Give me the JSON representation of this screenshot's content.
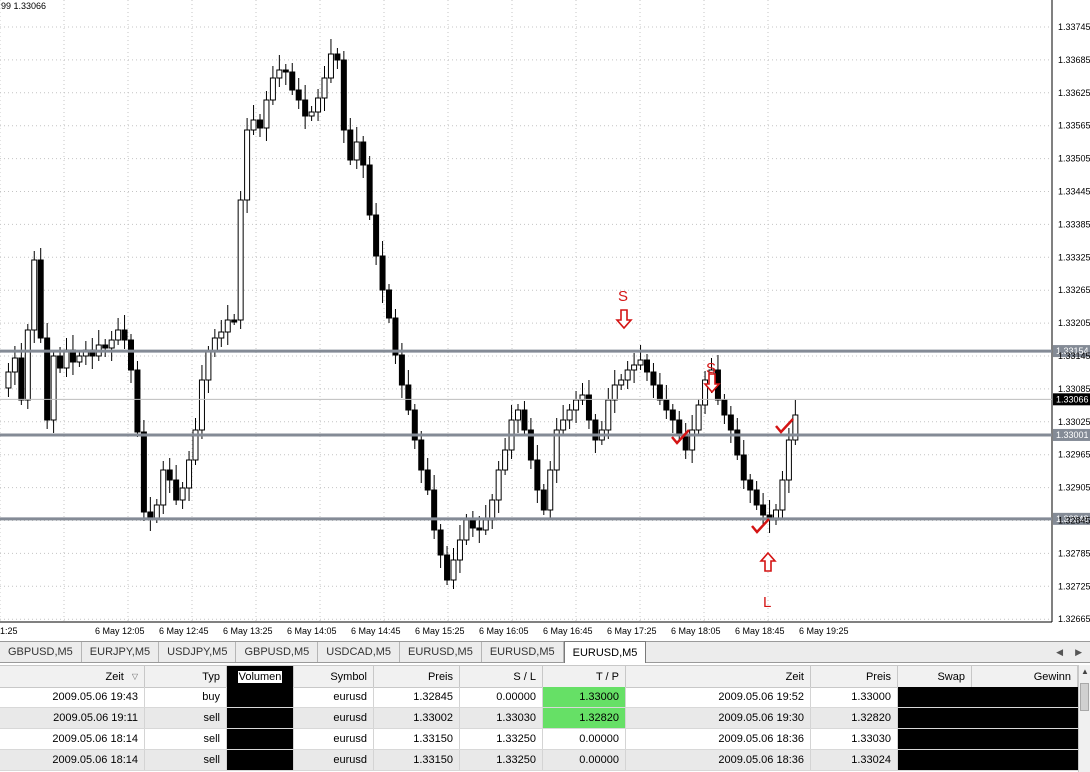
{
  "chart": {
    "header": "99 1.33066",
    "y_ticks": [
      "1.33745",
      "1.33685",
      "1.33625",
      "1.33565",
      "1.33505",
      "1.33445",
      "1.33385",
      "1.33325",
      "1.33265",
      "1.33205",
      "1.33145",
      "1.33085",
      "1.33025",
      "1.32965",
      "1.32905",
      "1.32845",
      "1.32785",
      "1.32725",
      "1.32665"
    ],
    "x_ticks": [
      "1:25",
      "6 May 12:05",
      "6 May 12:45",
      "6 May 13:25",
      "6 May 14:05",
      "6 May 14:45",
      "6 May 15:25",
      "6 May 16:05",
      "6 May 16:45",
      "6 May 17:25",
      "6 May 18:05",
      "6 May 18:45",
      "6 May 19:25"
    ],
    "levels": [
      {
        "label": "1.33154",
        "value": 1.33154
      },
      {
        "label": "1.33001",
        "value": 1.33001
      },
      {
        "label": "1.32848",
        "value": 1.32848
      }
    ],
    "current_price": "1.33066",
    "annotations": {
      "sell_1": "S",
      "sell_2": "S",
      "long": "L"
    },
    "colors": {
      "level_line": "#848b96",
      "annotation": "#d41414",
      "bull": "#ffffff",
      "bear": "#000000"
    }
  },
  "tabs": [
    "GBPUSD,M5",
    "EURJPY,M5",
    "USDJPY,M5",
    "GBPUSD,M5",
    "USDCAD,M5",
    "EURUSD,M5",
    "EURUSD,M5",
    "EURUSD,M5"
  ],
  "active_tab": 7,
  "table": {
    "headers": {
      "zeit": "Zeit",
      "typ": "Typ",
      "volumen": "Volumen",
      "symbol": "Symbol",
      "preis": "Preis",
      "sl": "S / L",
      "tp": "T / P",
      "zeit2": "Zeit",
      "preis2": "Preis",
      "swap": "Swap",
      "gewinn": "Gewinn"
    },
    "rows": [
      {
        "zeit": "2009.05.06 19:43",
        "typ": "buy",
        "symbol": "eurusd",
        "preis": "1.32845",
        "sl": "0.00000",
        "tp": "1.33000",
        "zeit2": "2009.05.06 19:52",
        "preis2": "1.33000"
      },
      {
        "zeit": "2009.05.06 19:11",
        "typ": "sell",
        "symbol": "eurusd",
        "preis": "1.33002",
        "sl": "1.33030",
        "tp": "1.32820",
        "zeit2": "2009.05.06 19:30",
        "preis2": "1.32820"
      },
      {
        "zeit": "2009.05.06 18:14",
        "typ": "sell",
        "symbol": "eurusd",
        "preis": "1.33150",
        "sl": "1.33250",
        "tp": "0.00000",
        "zeit2": "2009.05.06 18:36",
        "preis2": "1.33030"
      },
      {
        "zeit": "2009.05.06 18:14",
        "typ": "sell",
        "symbol": "eurusd",
        "preis": "1.33150",
        "sl": "1.33250",
        "tp": "0.00000",
        "zeit2": "2009.05.06 18:36",
        "preis2": "1.33024"
      }
    ]
  }
}
